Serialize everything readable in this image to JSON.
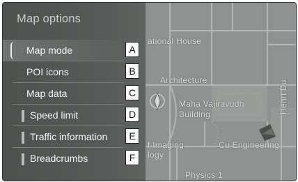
{
  "menu": {
    "title": "Map options",
    "items": [
      {
        "label": "Map mode",
        "callout": "A",
        "selected": true
      },
      {
        "label": "POI icons",
        "callout": "B"
      },
      {
        "label": "Map data",
        "callout": "C"
      },
      {
        "label": "Speed limit",
        "callout": "D",
        "marker": true
      },
      {
        "label": "Traffic information",
        "callout": "E",
        "marker": true
      },
      {
        "label": "Breadcrumbs",
        "callout": "F",
        "marker": true
      }
    ]
  },
  "map": {
    "labels": {
      "national_house": "ational House",
      "architecture": "Architecture",
      "maha_1": "Maha Vajiravudh",
      "maha_2": "Building",
      "engineering": "Cu Engineering",
      "physics": "Physics 1",
      "henri": "Henri Du",
      "imaging": "f Imaging",
      "ogy": "logy"
    },
    "icons": [
      "compass-icon",
      "vehicle-position-icon"
    ]
  }
}
